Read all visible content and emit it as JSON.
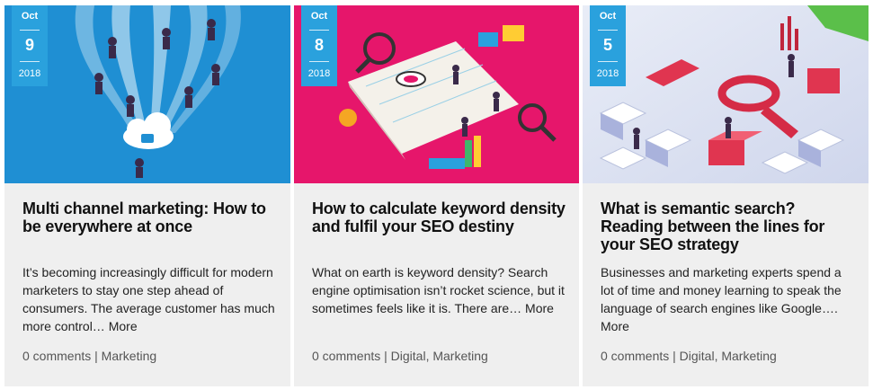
{
  "cards": [
    {
      "date": {
        "month": "Oct",
        "day": "9",
        "year": "2018"
      },
      "title": "Multi channel marketing: How to be everywhere at once",
      "excerpt": "It’s becoming increasingly difficult for modern marketers to stay one step ahead of consumers. The average customer has much more control…",
      "more": "More",
      "comments": "0 comments",
      "separator": "|",
      "categories": [
        "Marketing"
      ],
      "hero_color": "#1f8fd3"
    },
    {
      "date": {
        "month": "Oct",
        "day": "8",
        "year": "2018"
      },
      "title": "How to calculate keyword density and fulfil your SEO destiny",
      "excerpt": "What on earth is keyword density? Search engine optimisation isn’t rocket science, but it sometimes feels like it is. There are…",
      "more": "More",
      "comments": "0 comments",
      "separator": "|",
      "categories": [
        "Digital",
        "Marketing"
      ],
      "hero_color": "#e6166b"
    },
    {
      "date": {
        "month": "Oct",
        "day": "5",
        "year": "2018"
      },
      "title": "What is semantic search? Reading between the lines for your SEO strategy",
      "excerpt": "Businesses and marketing experts spend a lot of time and money learning to speak the language of search engines like Google….",
      "more": "More",
      "comments": "0 comments",
      "separator": "|",
      "categories": [
        "Digital",
        "Marketing"
      ],
      "hero_color": "#dfe4f2"
    }
  ]
}
